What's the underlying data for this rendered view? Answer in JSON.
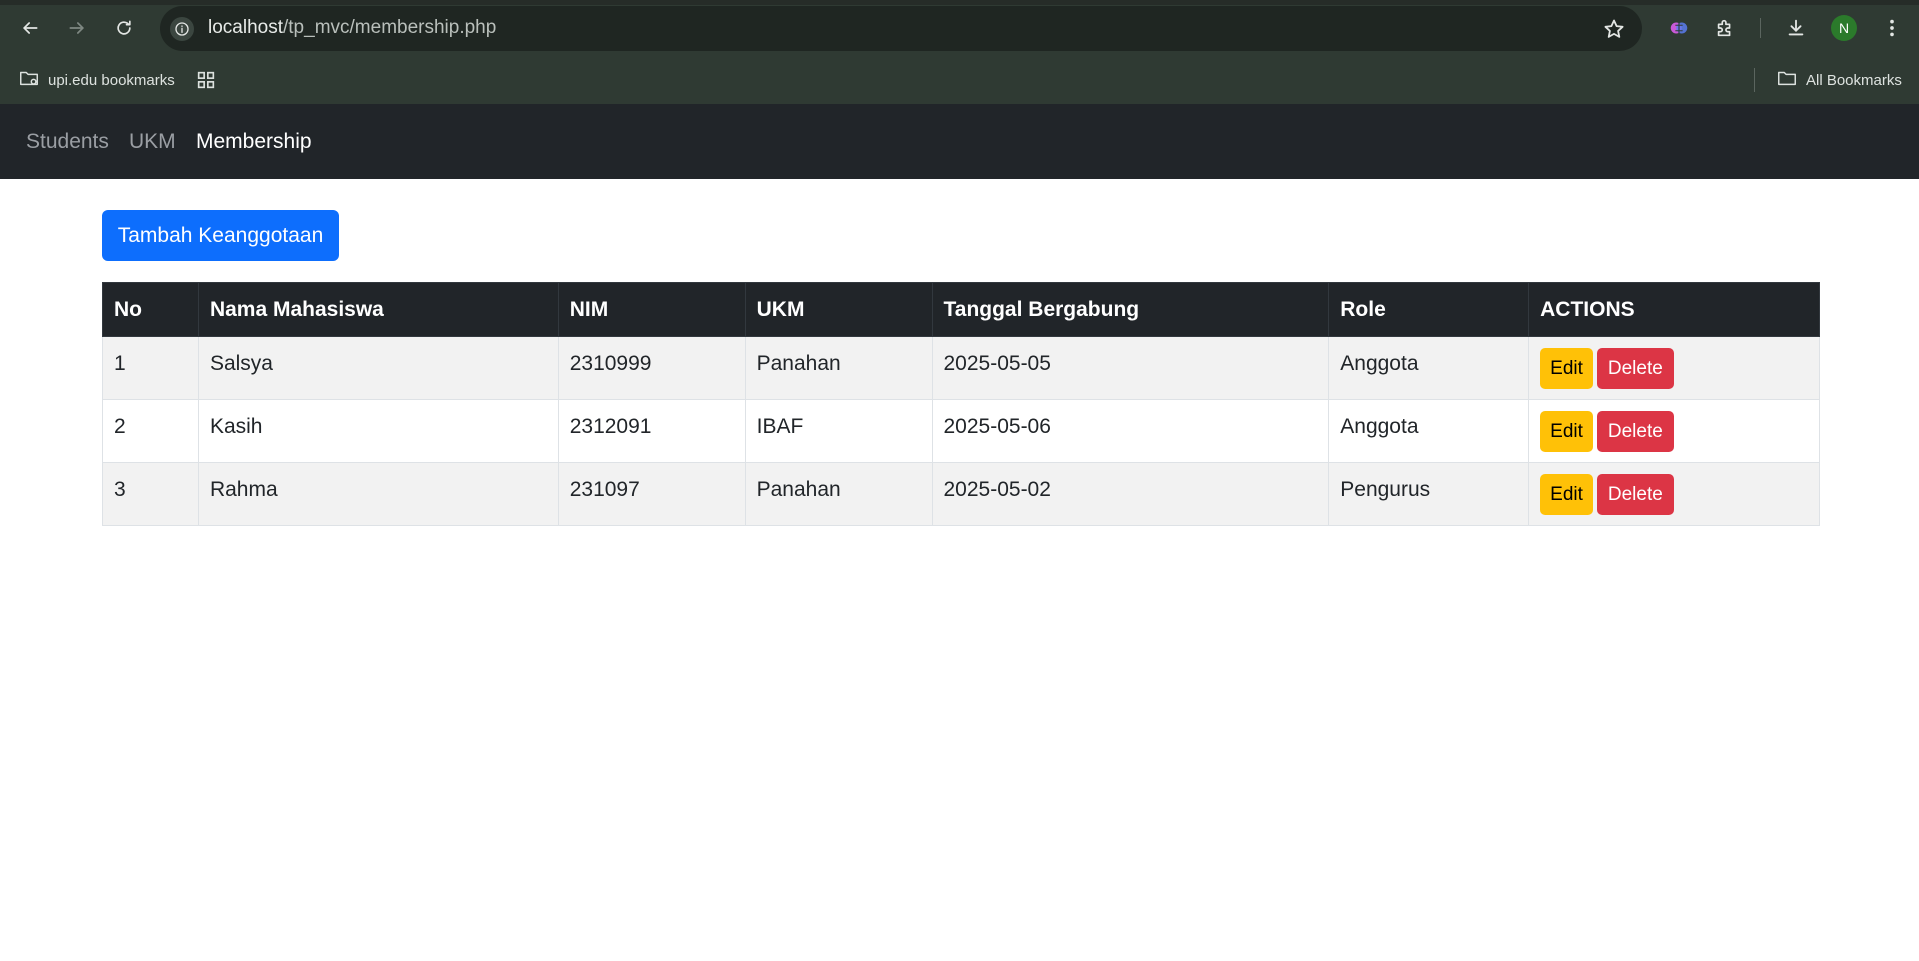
{
  "browser": {
    "url_host": "localhost",
    "url_path": "/tp_mvc/membership.php",
    "avatar_initial": "N",
    "bookmarks": {
      "left_folder": "upi.edu bookmarks",
      "right_folder": "All Bookmarks"
    },
    "icons": [
      "back-arrow-icon",
      "forward-arrow-icon",
      "reload-icon",
      "info-icon",
      "star-icon",
      "gemini-icon",
      "extensions-icon",
      "download-icon",
      "kebab-menu-icon",
      "folder-icon",
      "apps-grid-icon"
    ]
  },
  "navbar": {
    "items": [
      {
        "label": "Students",
        "active": false
      },
      {
        "label": "UKM",
        "active": false
      },
      {
        "label": "Membership",
        "active": true
      }
    ]
  },
  "main": {
    "add_button_label": "Tambah Keanggotaan",
    "table": {
      "headers": [
        "No",
        "Nama Mahasiswa",
        "NIM",
        "UKM",
        "Tanggal Bergabung",
        "Role",
        "ACTIONS"
      ],
      "rows": [
        {
          "no": "1",
          "nama": "Salsya",
          "nim": "2310999",
          "ukm": "Panahan",
          "tanggal": "2025-05-05",
          "role": "Anggota"
        },
        {
          "no": "2",
          "nama": "Kasih",
          "nim": "2312091",
          "ukm": "IBAF",
          "tanggal": "2025-05-06",
          "role": "Anggota"
        },
        {
          "no": "3",
          "nama": "Rahma",
          "nim": "231097",
          "ukm": "Panahan",
          "tanggal": "2025-05-02",
          "role": "Pengurus"
        }
      ],
      "edit_label": "Edit",
      "delete_label": "Delete"
    }
  },
  "colors": {
    "chrome_bg": "#2f3a33",
    "navbar_bg": "#212529",
    "primary": "#0d6efd",
    "warning": "#ffc107",
    "danger": "#dc3545"
  }
}
